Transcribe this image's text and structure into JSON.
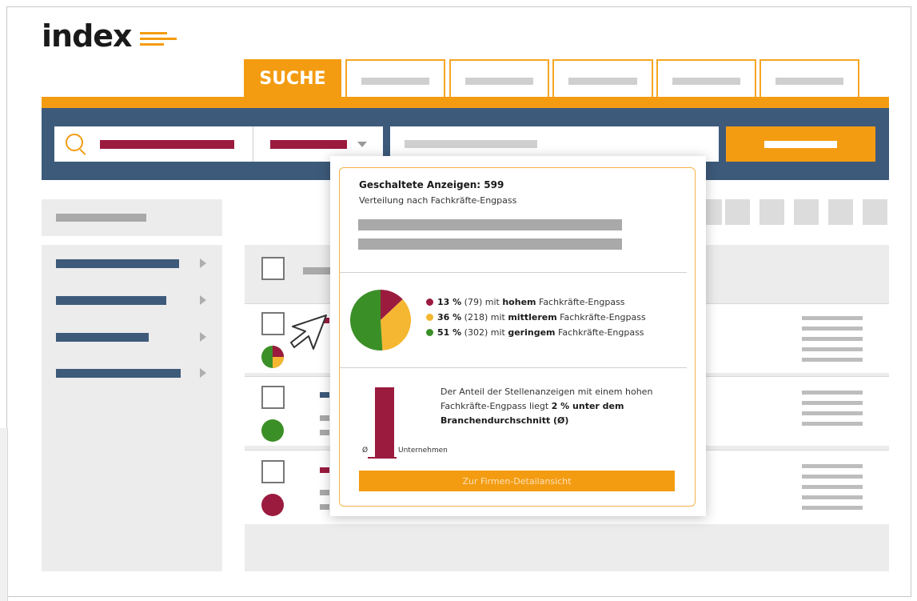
{
  "header": {
    "logo_text": "index",
    "active_tab": "SUCHE",
    "inactive_tab_count": 5
  },
  "popup": {
    "title": "Geschaltete Anzeigen: 599",
    "subtitle": "Verteilung nach Fachkräfte-Engpass",
    "legend": [
      {
        "pct": "13 %",
        "count": "(79)",
        "pre": " mit ",
        "level": "hohem",
        "post": " Fachkräfte-Engpass",
        "color": "#9b1b3f"
      },
      {
        "pct": "36 %",
        "count": "(218)",
        "pre": " mit ",
        "level": "mittlerem",
        "post": " Fachkräfte-Engpass",
        "color": "#f5b731"
      },
      {
        "pct": "51 %",
        "count": "(302)",
        "pre": " mit ",
        "level": "geringem",
        "post": " Fachkräfte-Engpass",
        "color": "#3b8f27"
      }
    ],
    "pie_values": [
      13,
      36,
      51
    ],
    "bar": {
      "avg_label": "Ø",
      "company_label": "Unternehmen",
      "text_pre": "Der Anteil der Stellenanzeigen mit einem hohen Fachkräfte-Engpass liegt ",
      "text_bold": "2 % unter dem Branchendurchschnitt (Ø)"
    },
    "detail_button": "Zur Firmen-Detailansicht"
  },
  "colors": {
    "orange": "#f39c12",
    "navy": "#3d5a7a",
    "crimson": "#9b1b3f",
    "yellow": "#f5b731",
    "green": "#3b8f27"
  },
  "icons": [
    "search-icon",
    "chevron-down-icon",
    "cursor-icon"
  ]
}
